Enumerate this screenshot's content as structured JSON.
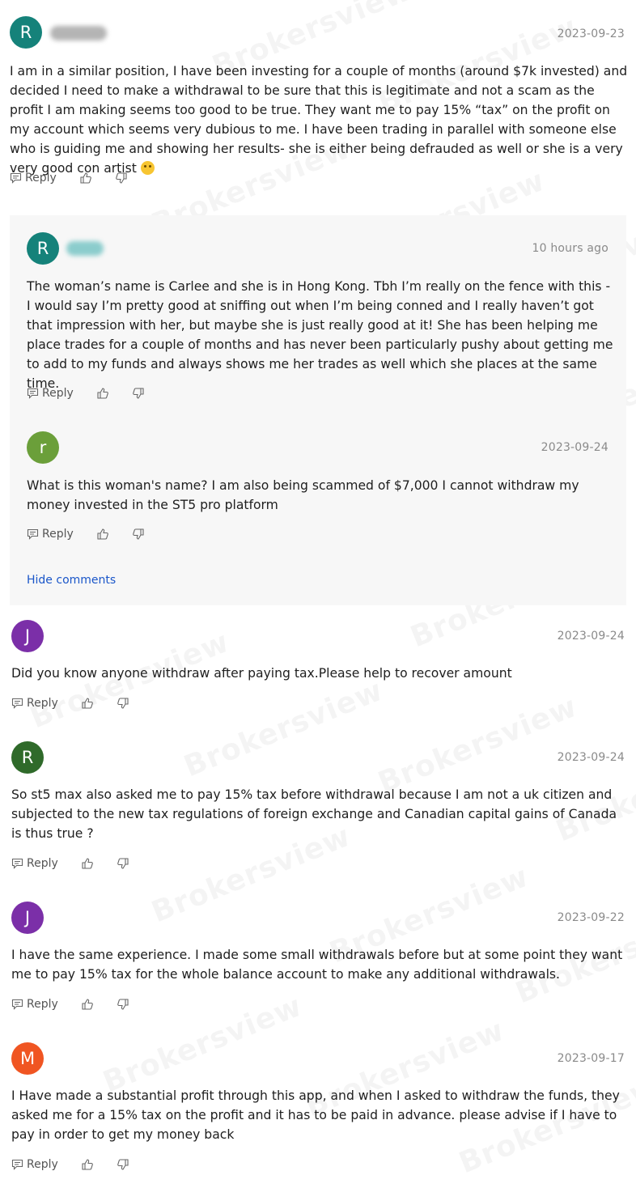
{
  "comments": [
    {
      "initial": "R",
      "avatar_color": "#15827a",
      "date": "2023-09-23",
      "text": "I am in a similar position, I have been investing for a couple of months (around $7k invested) and decided I need to make a withdrawal to be sure that this is legitimate and not a scam as the profit I am making seems too good to be true. They want me to pay 15% “tax” on the profit on my account which seems very dubious to me. I have been trading in parallel with someone else who is guiding me and showing her results- she is either being defrauded as well or she is a very very good con artist",
      "reply_label": "Reply"
    },
    {
      "initial": "R",
      "avatar_color": "#15827a",
      "date": "10 hours ago",
      "text": "The woman’s name is Carlee and she is in Hong Kong. Tbh I’m really on the fence with this - I would say I’m pretty good at sniffing out when I’m being conned and I really haven’t got that impression with her, but maybe she is just really good at it! She has been helping me place trades for a couple of months and has never been particularly pushy about getting me to add to my funds and always shows me her trades as well which she places at the same time.",
      "reply_label": "Reply"
    },
    {
      "initial": "r",
      "avatar_color": "#6b9f3a",
      "date": "2023-09-24",
      "text": "What is this woman's name? I am also being scammed of $7,000 I cannot withdraw my money invested in the ST5 pro platform",
      "reply_label": "Reply"
    },
    {
      "initial": "J",
      "avatar_color": "#7b2fa8",
      "date": "2023-09-24",
      "text": "Did you know anyone withdraw after paying tax.Please help to recover amount",
      "reply_label": "Reply"
    },
    {
      "initial": "R",
      "avatar_color": "#2f6a2a",
      "date": "2023-09-24",
      "text": "So st5 max also asked me to pay 15% tax before withdrawal because I am not a uk citizen and subjected to the new tax regulations of foreign exchange and Canadian capital gains of Canada is thus true ?",
      "reply_label": "Reply"
    },
    {
      "initial": "J",
      "avatar_color": "#7b2fa8",
      "date": "2023-09-22",
      "text": "I have the same experience. I made some small withdrawals before but at some point they want me to pay 15% tax for the whole balance account to make any additional withdrawals.",
      "reply_label": "Reply"
    },
    {
      "initial": "M",
      "avatar_color": "#f05522",
      "date": "2023-09-17",
      "text": "I Have made a substantial profit through this app, and when I asked to withdraw the funds, they asked me for a 15% tax on the profit and it has to be paid in advance. please advise if I have to pay in order to get my money back",
      "reply_label": "Reply"
    }
  ],
  "hide_comments_label": "Hide comments",
  "watermark_text": "Brokersview",
  "icons": {
    "reply": "comment-icon",
    "like": "thumbs-up-icon",
    "dislike": "thumbs-down-icon",
    "emoji": "thinking-face-emoji"
  }
}
